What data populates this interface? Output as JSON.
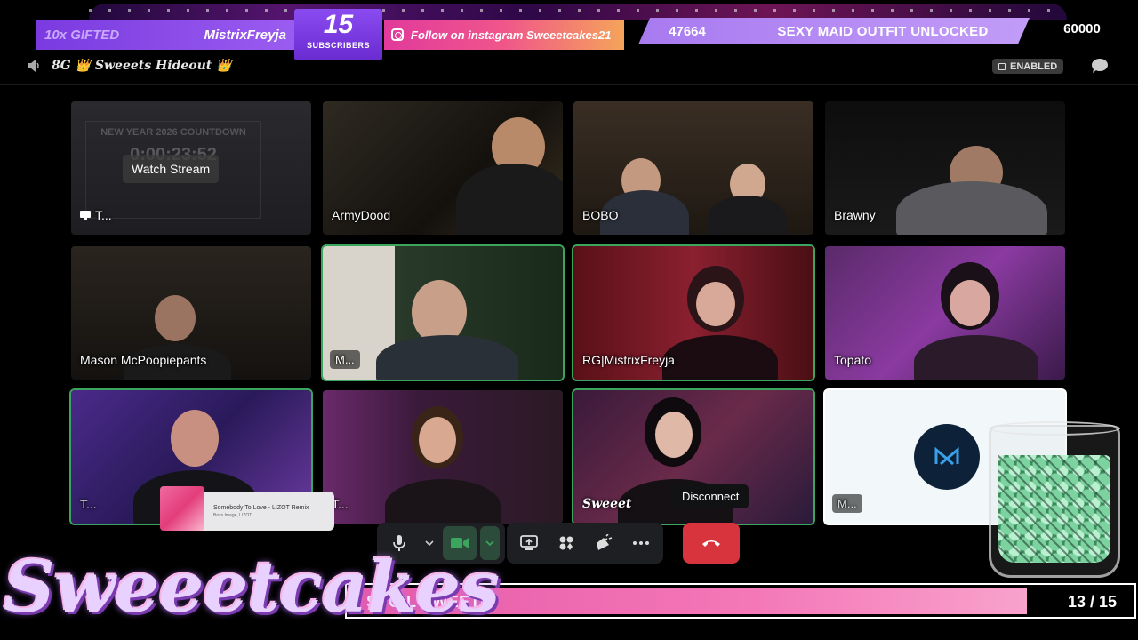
{
  "overlay": {
    "gifted_count": "10x GIFTED",
    "gifted_name": "MistrixFreyja",
    "subscribers_count": "15",
    "subscribers_label": "SUBSCRIBERS",
    "instagram_text": "Follow on instagram Sweeetcakes21",
    "goal_current": "47664",
    "goal_text": "SEXY MAID OUTFIT UNLOCKED",
    "goal_total": "60000",
    "brand": "Sweeetcakes",
    "progress_label": "SPOIL SWEETS",
    "progress_count": "13 / 15",
    "progress_fraction": 0.8667
  },
  "channel": {
    "server_name": "8G 👑 Sweeets Hideout 👑",
    "enabled_badge": "ENABLED"
  },
  "tiles": [
    {
      "name": "T...",
      "speaking": false
    },
    {
      "name": "ArmyDood",
      "speaking": false
    },
    {
      "name": "BOBO",
      "speaking": false
    },
    {
      "name": "Brawny",
      "speaking": false
    },
    {
      "name": "Mason McPoopiepants",
      "speaking": false
    },
    {
      "name": "M...",
      "speaking": true
    },
    {
      "name": "RG|MistrixFreyja",
      "speaking": true
    },
    {
      "name": "Topato",
      "speaking": false
    },
    {
      "name": "T...",
      "speaking": true
    },
    {
      "name": "T...",
      "speaking": false
    },
    {
      "name": "Sweeet",
      "speaking": true
    },
    {
      "name": "M...",
      "speaking": false
    }
  ],
  "stream_tile": {
    "watch_label": "Watch Stream",
    "countdown_title": "NEW YEAR 2026 COUNTDOWN",
    "countdown_time": "0:00:23:52"
  },
  "music": {
    "title": "Somebody To Love - LIZOT Remix",
    "artist": "Boss Image, LIZOT"
  },
  "controls": {
    "disconnect_tooltip": "Disconnect"
  },
  "colors": {
    "speaking_border": "#3ba55d",
    "disconnect": "#d8343e",
    "goal_bar": "#b48af4",
    "progress": "#f478b8"
  }
}
